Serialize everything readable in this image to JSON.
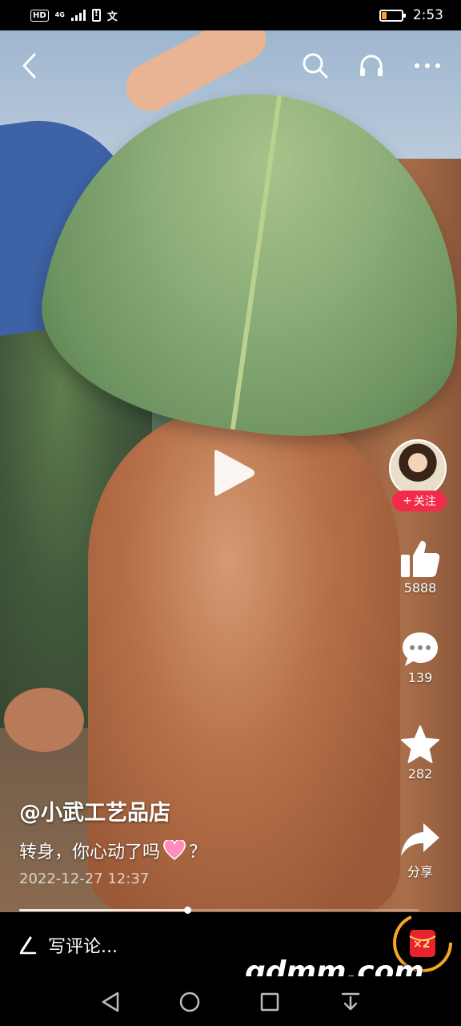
{
  "status_bar": {
    "hd": "HD",
    "network": "4G",
    "time": "2:53",
    "battery_level": 0.25,
    "battery_color": "#f5a623"
  },
  "top_nav": {
    "back_icon": "chevron-left-icon",
    "search_icon": "search-icon",
    "listen_icon": "headphones-icon",
    "more_icon": "more-dots-icon"
  },
  "video": {
    "play_icon": "play-icon"
  },
  "right_rail": {
    "follow_label": "关注",
    "follow_prefix": "+",
    "likes": "5888",
    "comments": "139",
    "favorites": "282",
    "share_label": "分享",
    "accent": "#f22b4b"
  },
  "caption": {
    "author": "@小武工艺品店",
    "text_before": "转身，你心动了吗",
    "text_after": "？",
    "emoji": "pink-heart-icon",
    "date": "2022-12-27 12:37"
  },
  "playback": {
    "progress": 0.42
  },
  "comment_bar": {
    "placeholder": "写评论..."
  },
  "reward": {
    "label": "×2",
    "color": "#e8232e"
  },
  "watermark": "gdmm.com",
  "system_nav": {
    "back_icon": "triangle-back-icon",
    "home_icon": "circle-home-icon",
    "recents_icon": "square-recents-icon",
    "notify_icon": "pull-down-icon"
  }
}
